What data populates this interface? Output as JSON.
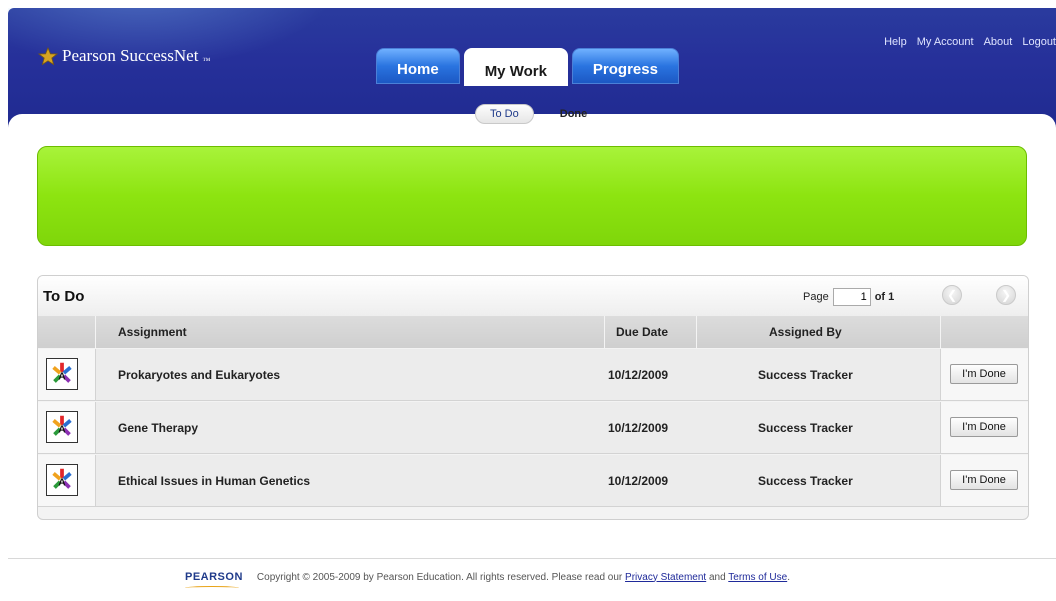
{
  "app": {
    "name": "Pearson SuccessNet",
    "tm": "™"
  },
  "top_links": [
    "Help",
    "My Account",
    "About",
    "Logout"
  ],
  "tabs": [
    {
      "label": "Home",
      "active": false
    },
    {
      "label": "My Work",
      "active": true
    },
    {
      "label": "Progress",
      "active": false
    }
  ],
  "subtabs": {
    "todo": "To Do",
    "done": "Done"
  },
  "todo_panel": {
    "title": "To Do",
    "page_label": "Page",
    "page_value": "1",
    "page_of": "of 1",
    "columns": {
      "assignment": "Assignment",
      "due_date": "Due Date",
      "assigned_by": "Assigned By"
    },
    "rows": [
      {
        "assignment": "Prokaryotes and Eukaryotes",
        "due_date": "10/12/2009",
        "assigned_by": "Success Tracker",
        "action": "I'm Done"
      },
      {
        "assignment": "Gene Therapy",
        "due_date": "10/12/2009",
        "assigned_by": "Success Tracker",
        "action": "I'm Done"
      },
      {
        "assignment": "Ethical Issues in Human Genetics",
        "due_date": "10/12/2009",
        "assigned_by": "Success Tracker",
        "action": "I'm Done"
      }
    ]
  },
  "footer": {
    "brand": "PEARSON",
    "copyright": "Copyright © 2005-2009 by Pearson Education. All rights reserved. Please read our",
    "privacy": "Privacy Statement",
    "and": "and",
    "terms": "Terms of Use",
    "period": "."
  },
  "colors": {
    "header_blue": "#26309a",
    "tab_blue": "#2a74e0",
    "banner_green": "#8de410",
    "link_blue": "#1f2a9a"
  }
}
